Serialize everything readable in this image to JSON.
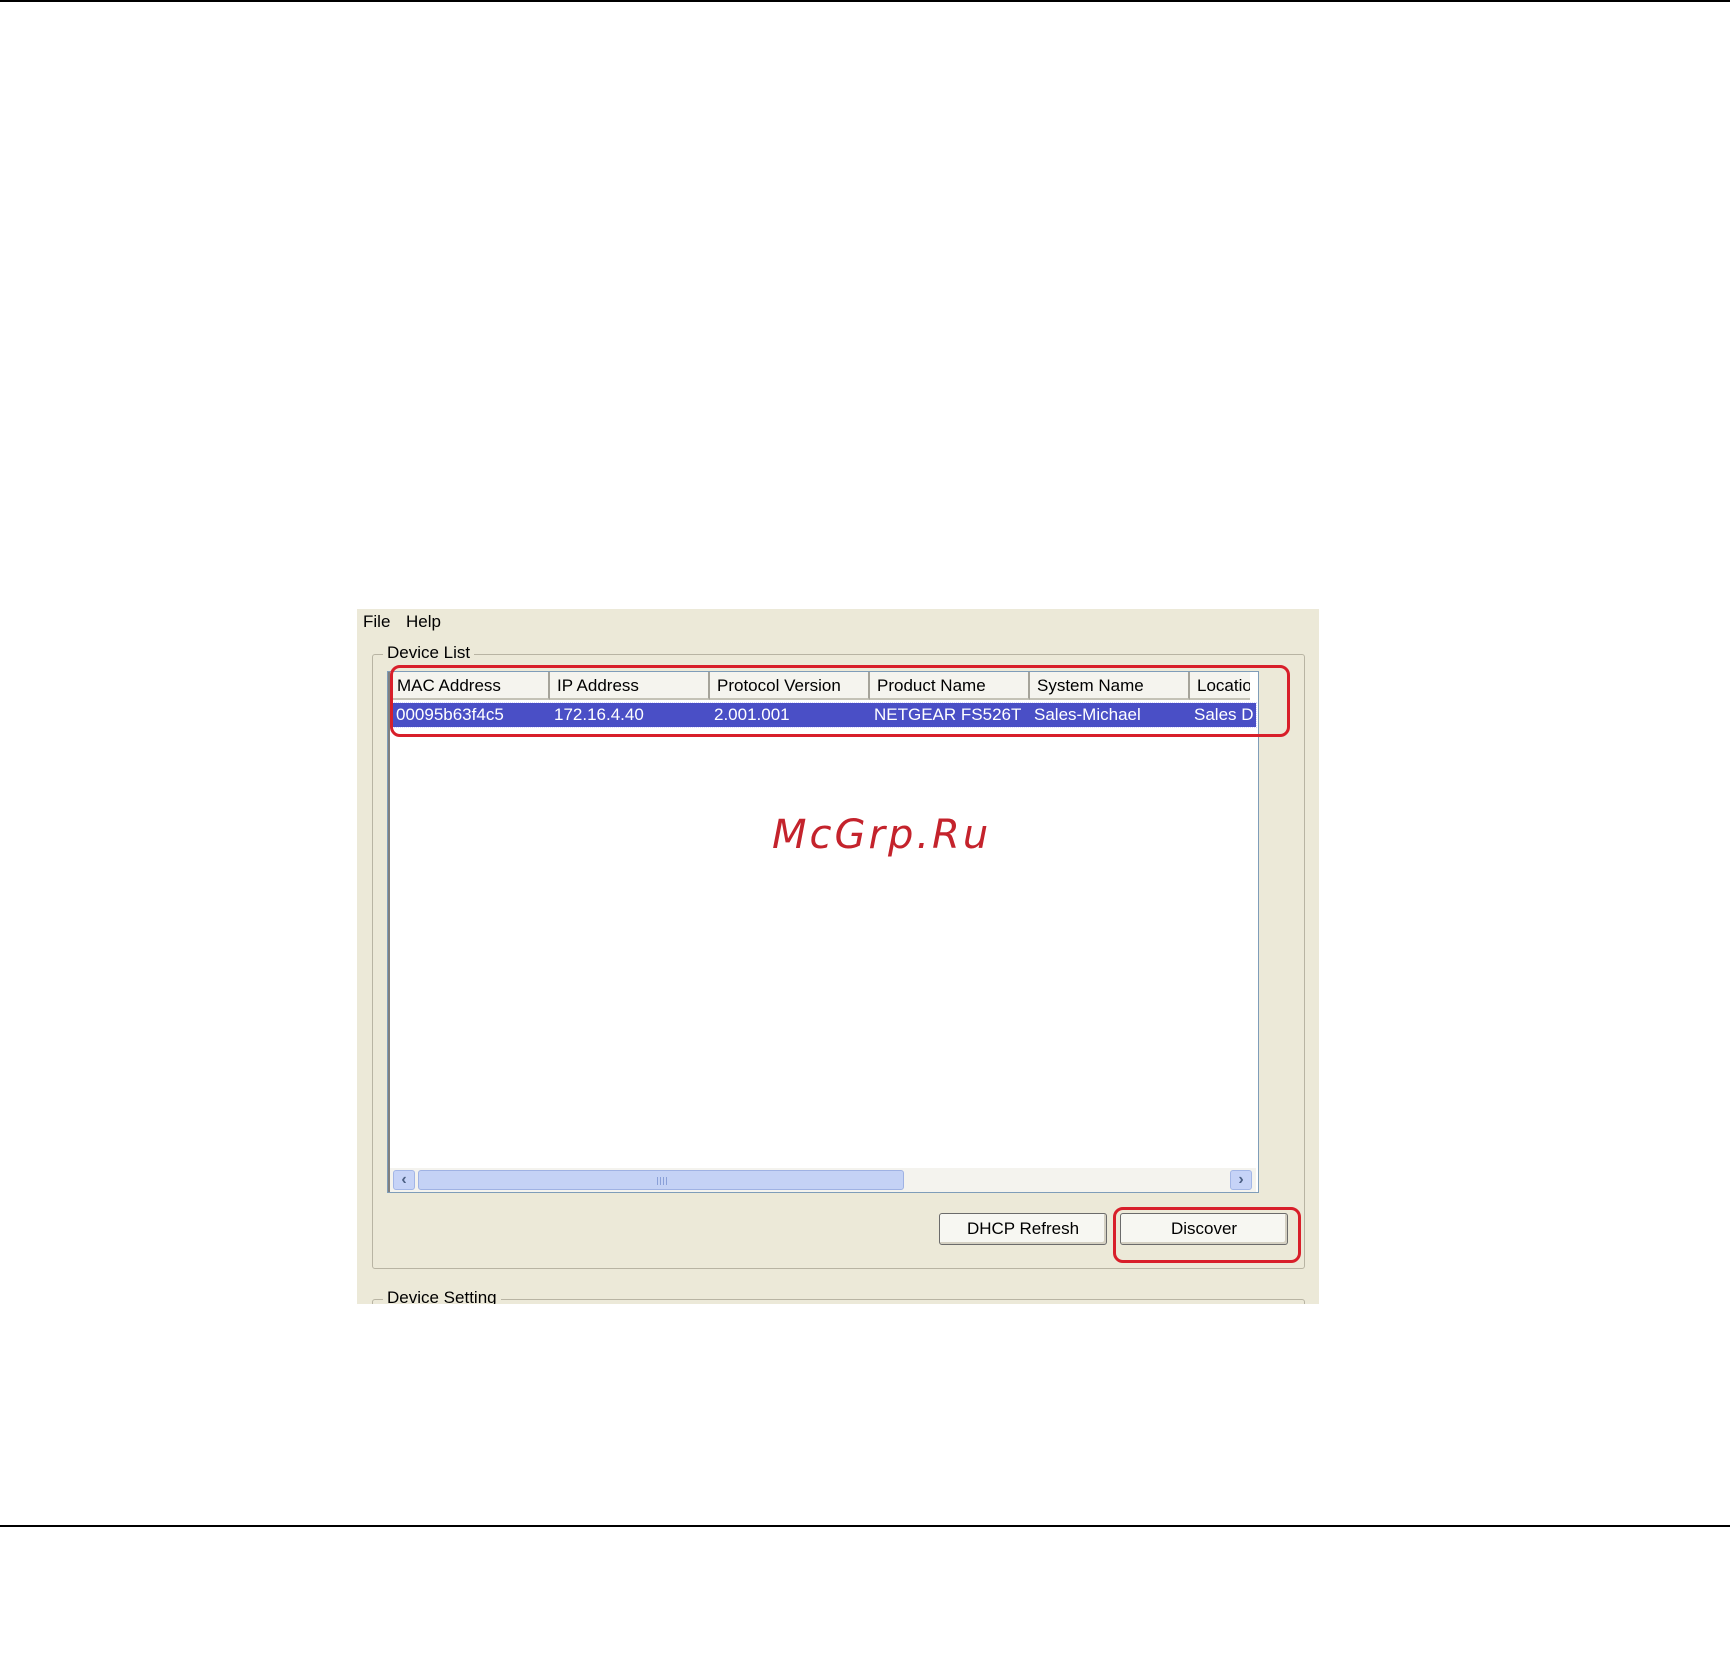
{
  "menu": {
    "file": "File",
    "help": "Help"
  },
  "device_list": {
    "title": "Device List",
    "columns": [
      "MAC Address",
      "IP Address",
      "Protocol Version",
      "Product Name",
      "System Name",
      "Locatio"
    ],
    "rows": [
      [
        "00095b63f4c5",
        "172.16.4.40",
        "2.001.001",
        "NETGEAR FS526T",
        "Sales-Michael",
        "Sales D"
      ]
    ],
    "scrollbar": {
      "position_fraction": 0.0,
      "visible_fraction": 0.56
    }
  },
  "buttons": {
    "dhcp_refresh": "DHCP Refresh",
    "discover": "Discover"
  },
  "device_setting": {
    "title": "Device Setting"
  },
  "watermark": "McGrp.Ru",
  "colors": {
    "selection": "#4a4fc6",
    "highlight": "#d81f2a",
    "window_bg": "#ece9d8"
  }
}
